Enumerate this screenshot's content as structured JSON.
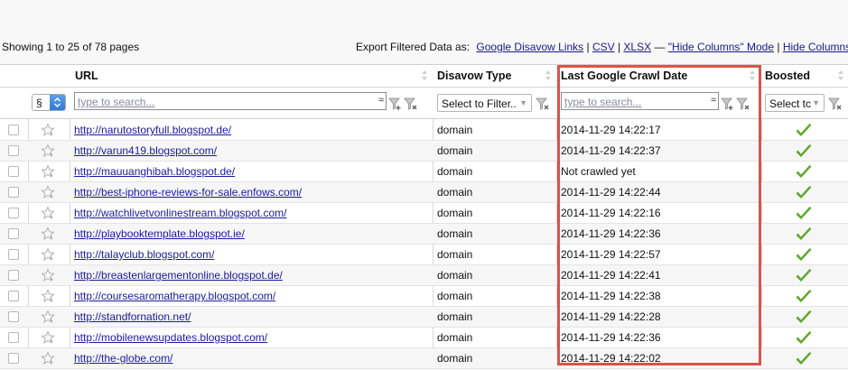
{
  "toolbar": {
    "showing_text": "Showing 1 to 25 of 78 pages",
    "export_label": "Export Filtered Data as:",
    "links": [
      "Google Disavow Links",
      "CSV",
      "XLSX"
    ],
    "separators": [
      " | ",
      " | ",
      " — "
    ],
    "hide_columns_mode": "\"Hide Columns\" Mode",
    "hide_columns": "Hide Columns"
  },
  "columns": {
    "url": "URL",
    "disavow_type": "Disavow Type",
    "last_crawl": "Last Google Crawl Date",
    "boosted": "Boosted"
  },
  "filters": {
    "page_size_value": "§",
    "url_search_placeholder": "type to search...",
    "disavow_select": "Select to Filter..",
    "crawl_search_placeholder": "type to search...",
    "boosted_select": "Select tc",
    "approx_symbol": "≈"
  },
  "rows": [
    {
      "url": "http://narutostoryfull.blogspot.de/",
      "type": "domain",
      "crawl": "2014-11-29 14:22:17",
      "boosted": true
    },
    {
      "url": "http://varun419.blogspot.com/",
      "type": "domain",
      "crawl": "2014-11-29 14:22:37",
      "boosted": true
    },
    {
      "url": "http://mauuanghibah.blogspot.de/",
      "type": "domain",
      "crawl": "Not crawled yet",
      "boosted": true
    },
    {
      "url": "http://best-iphone-reviews-for-sale.enfows.com/",
      "type": "domain",
      "crawl": "2014-11-29 14:22:44",
      "boosted": true
    },
    {
      "url": "http://watchlivetvonlinestream.blogspot.com/",
      "type": "domain",
      "crawl": "2014-11-29 14:22:16",
      "boosted": true
    },
    {
      "url": "http://playbooktemplate.blogspot.ie/",
      "type": "domain",
      "crawl": "2014-11-29 14:22:36",
      "boosted": true
    },
    {
      "url": "http://talayclub.blogspot.com/",
      "type": "domain",
      "crawl": "2014-11-29 14:22:57",
      "boosted": true
    },
    {
      "url": "http://breastenlargementonline.blogspot.de/",
      "type": "domain",
      "crawl": "2014-11-29 14:22:41",
      "boosted": true
    },
    {
      "url": "http://coursesaromatherapy.blogspot.com/",
      "type": "domain",
      "crawl": "2014-11-29 14:22:38",
      "boosted": true
    },
    {
      "url": "http://standfornation.net/",
      "type": "domain",
      "crawl": "2014-11-29 14:22:28",
      "boosted": true
    },
    {
      "url": "http://mobilenewsupdates.blogspot.com/",
      "type": "domain",
      "crawl": "2014-11-29 14:22:36",
      "boosted": true
    },
    {
      "url": "http://the-globe.com/",
      "type": "domain",
      "crawl": "2014-11-29 14:22:02",
      "boosted": true
    }
  ],
  "colors": {
    "highlight": "#d9534a",
    "link": "#1a1aa0",
    "check": "#5fa82b"
  }
}
